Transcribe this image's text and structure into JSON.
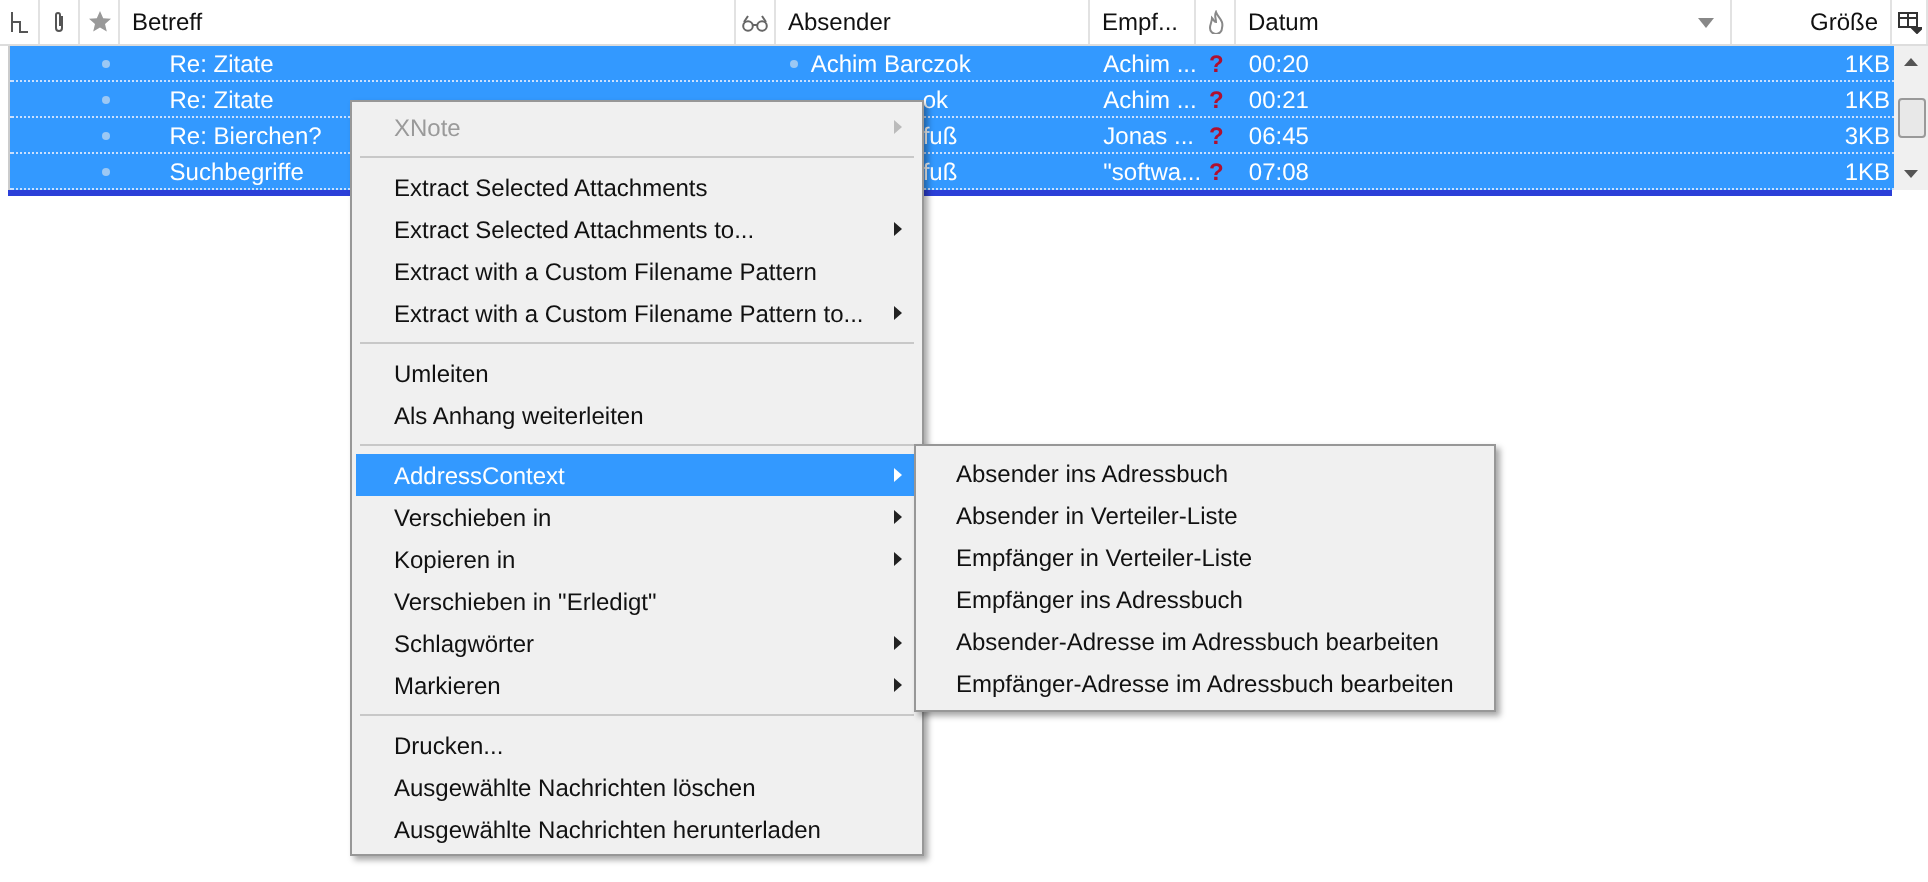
{
  "columns": [
    {
      "kind": "thread-icon"
    },
    {
      "kind": "attachment-icon"
    },
    {
      "kind": "star-icon"
    },
    {
      "kind": "text",
      "label": "Betreff"
    },
    {
      "kind": "read-icon"
    },
    {
      "kind": "text",
      "label": "Absender"
    },
    {
      "kind": "text",
      "label": "Empf..."
    },
    {
      "kind": "junk-icon"
    },
    {
      "kind": "sort",
      "label": "Datum"
    },
    {
      "kind": "size",
      "label": "Größe"
    },
    {
      "kind": "picker-icon"
    }
  ],
  "rows": [
    {
      "subject": "Re: Zitate",
      "sender": "Achim Barczok",
      "covered": false,
      "recipient": "Achim ...",
      "junk": "?",
      "time": "00:20",
      "size": "1KB",
      "selected": true
    },
    {
      "subject": "Re: Zitate",
      "sender": "ok",
      "covered": true,
      "recipient": "Achim ...",
      "junk": "?",
      "time": "00:21",
      "size": "1KB",
      "selected": true
    },
    {
      "subject": "Re: Bierchen?",
      "sender": "fuß",
      "covered": true,
      "recipient": "Jonas ...",
      "junk": "?",
      "time": "06:45",
      "size": "3KB",
      "selected": true
    },
    {
      "subject": "Suchbegriffe",
      "sender": "fuß",
      "covered": true,
      "recipient": "\"softwa...",
      "junk": "?",
      "time": "07:08",
      "size": "1KB",
      "selected": true
    }
  ],
  "context_menu": [
    {
      "kind": "item",
      "label": "XNote",
      "disabled": true,
      "submenu": true,
      "selected": false
    },
    {
      "kind": "separator"
    },
    {
      "kind": "item",
      "label": "Extract Selected Attachments",
      "disabled": false,
      "submenu": false,
      "selected": false
    },
    {
      "kind": "item",
      "label": "Extract Selected Attachments to...",
      "disabled": false,
      "submenu": true,
      "selected": false
    },
    {
      "kind": "item",
      "label": "Extract with a Custom Filename Pattern",
      "disabled": false,
      "submenu": false,
      "selected": false
    },
    {
      "kind": "item",
      "label": "Extract with a Custom Filename Pattern to...",
      "disabled": false,
      "submenu": true,
      "selected": false
    },
    {
      "kind": "separator"
    },
    {
      "kind": "item",
      "label": "Umleiten",
      "disabled": false,
      "submenu": false,
      "selected": false
    },
    {
      "kind": "item",
      "label": "Als Anhang weiterleiten",
      "disabled": false,
      "submenu": false,
      "selected": false
    },
    {
      "kind": "separator"
    },
    {
      "kind": "item",
      "label": "AddressContext",
      "disabled": false,
      "submenu": true,
      "selected": true
    },
    {
      "kind": "item",
      "label": "Verschieben in",
      "disabled": false,
      "submenu": true,
      "selected": false
    },
    {
      "kind": "item",
      "label": "Kopieren in",
      "disabled": false,
      "submenu": true,
      "selected": false
    },
    {
      "kind": "item",
      "label": "Verschieben in \"Erledigt\"",
      "disabled": false,
      "submenu": false,
      "selected": false
    },
    {
      "kind": "item",
      "label": "Schlagwörter",
      "disabled": false,
      "submenu": true,
      "selected": false
    },
    {
      "kind": "item",
      "label": "Markieren",
      "disabled": false,
      "submenu": true,
      "selected": false
    },
    {
      "kind": "separator"
    },
    {
      "kind": "item",
      "label": "Drucken...",
      "disabled": false,
      "submenu": false,
      "selected": false
    },
    {
      "kind": "item",
      "label": "Ausgewählte Nachrichten löschen",
      "disabled": false,
      "submenu": false,
      "selected": false
    },
    {
      "kind": "item",
      "label": "Ausgewählte Nachrichten herunterladen",
      "disabled": false,
      "submenu": false,
      "selected": false
    }
  ],
  "submenu": [
    "Absender ins Adressbuch",
    "Absender in Verteiler-Liste",
    "Empfänger in Verteiler-Liste",
    "Empfänger ins Adressbuch",
    "Absender-Adresse im Adressbuch bearbeiten",
    "Empfänger-Adresse im Adressbuch bearbeiten"
  ]
}
